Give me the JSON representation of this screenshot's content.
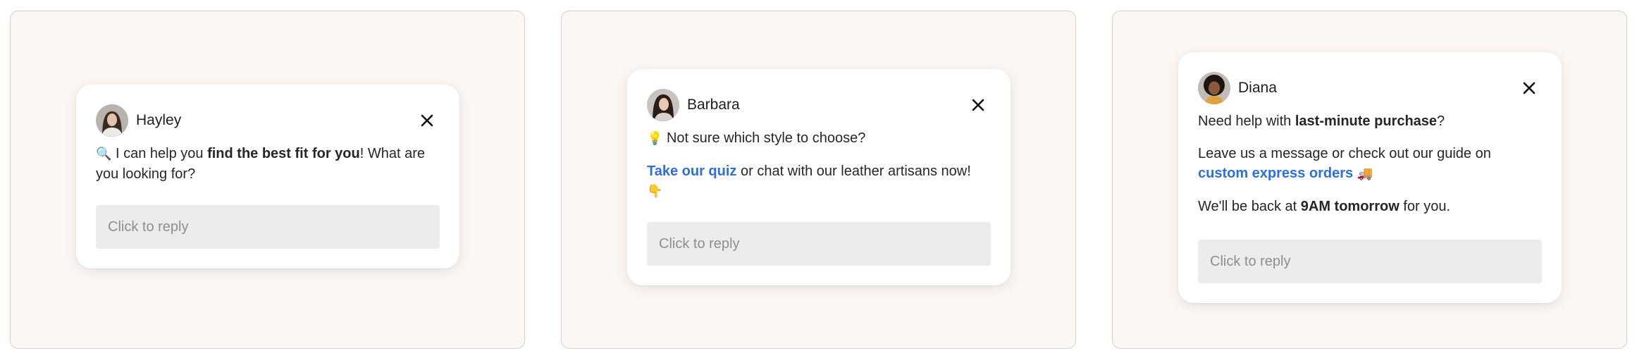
{
  "widgets": [
    {
      "agent_name": "Hayley",
      "line1": {
        "emoji": "🔍",
        "pre": " I can help you ",
        "bold": "find the best fit for you",
        "post": "! What are you looking for?"
      },
      "reply_placeholder": "Click to reply"
    },
    {
      "agent_name": "Barbara",
      "line1": {
        "emoji": "💡",
        "text": " Not sure which style to choose?"
      },
      "line2": {
        "link": "Take our quiz",
        "post": " or chat with our leather artisans now!",
        "emoji": "👇"
      },
      "reply_placeholder": "Click to reply"
    },
    {
      "agent_name": "Diana",
      "line1": {
        "pre": "Need help with ",
        "bold": "last-minute purchase",
        "post": "?"
      },
      "line2": {
        "pre": "Leave us a message or check out our guide on",
        "link": "custom express orders",
        "emoji": "🚚"
      },
      "line3": {
        "pre": "We'll be back at ",
        "bold": "9AM tomorrow",
        "post": " for you."
      },
      "reply_placeholder": "Click to reply"
    }
  ],
  "colors": {
    "background": "#fcf7f3",
    "link": "#2c6fe0",
    "reply_bg": "#ececec"
  },
  "icons": {
    "close": "close-icon"
  }
}
